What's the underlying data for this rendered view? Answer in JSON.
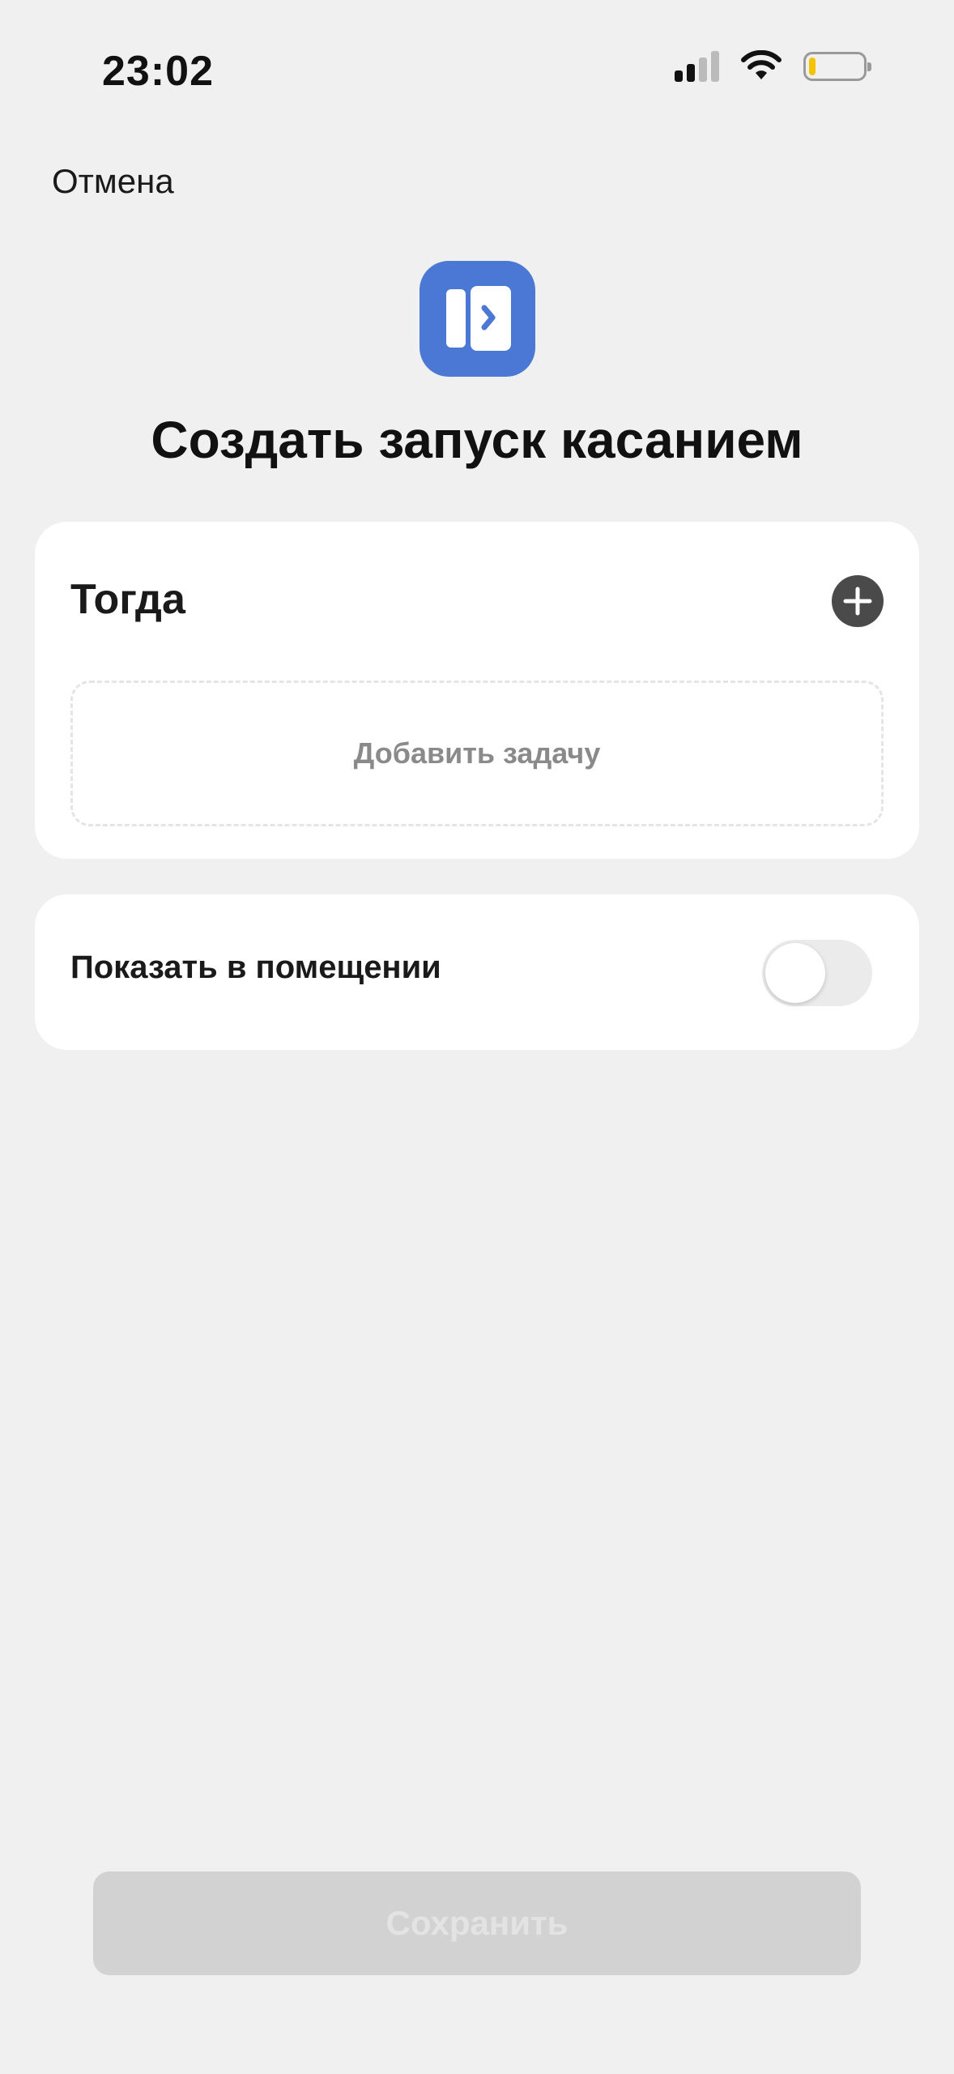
{
  "status_bar": {
    "time": "23:02",
    "signal_icon": "cellular-signal-icon",
    "wifi_icon": "wifi-icon",
    "battery_icon": "battery-icon",
    "battery_level": 0.12,
    "battery_color": "#f4c300"
  },
  "nav": {
    "cancel_label": "Отмена"
  },
  "header": {
    "icon": "tap-launch-icon",
    "icon_color": "#4a78d4",
    "title": "Создать запуск касанием"
  },
  "then_section": {
    "title": "Тогда",
    "add_icon": "plus-circle-icon",
    "add_task_label": "Добавить задачу"
  },
  "room_section": {
    "label": "Показать в помещении",
    "toggle_on": false
  },
  "footer": {
    "save_label": "Сохранить",
    "save_enabled": false
  }
}
